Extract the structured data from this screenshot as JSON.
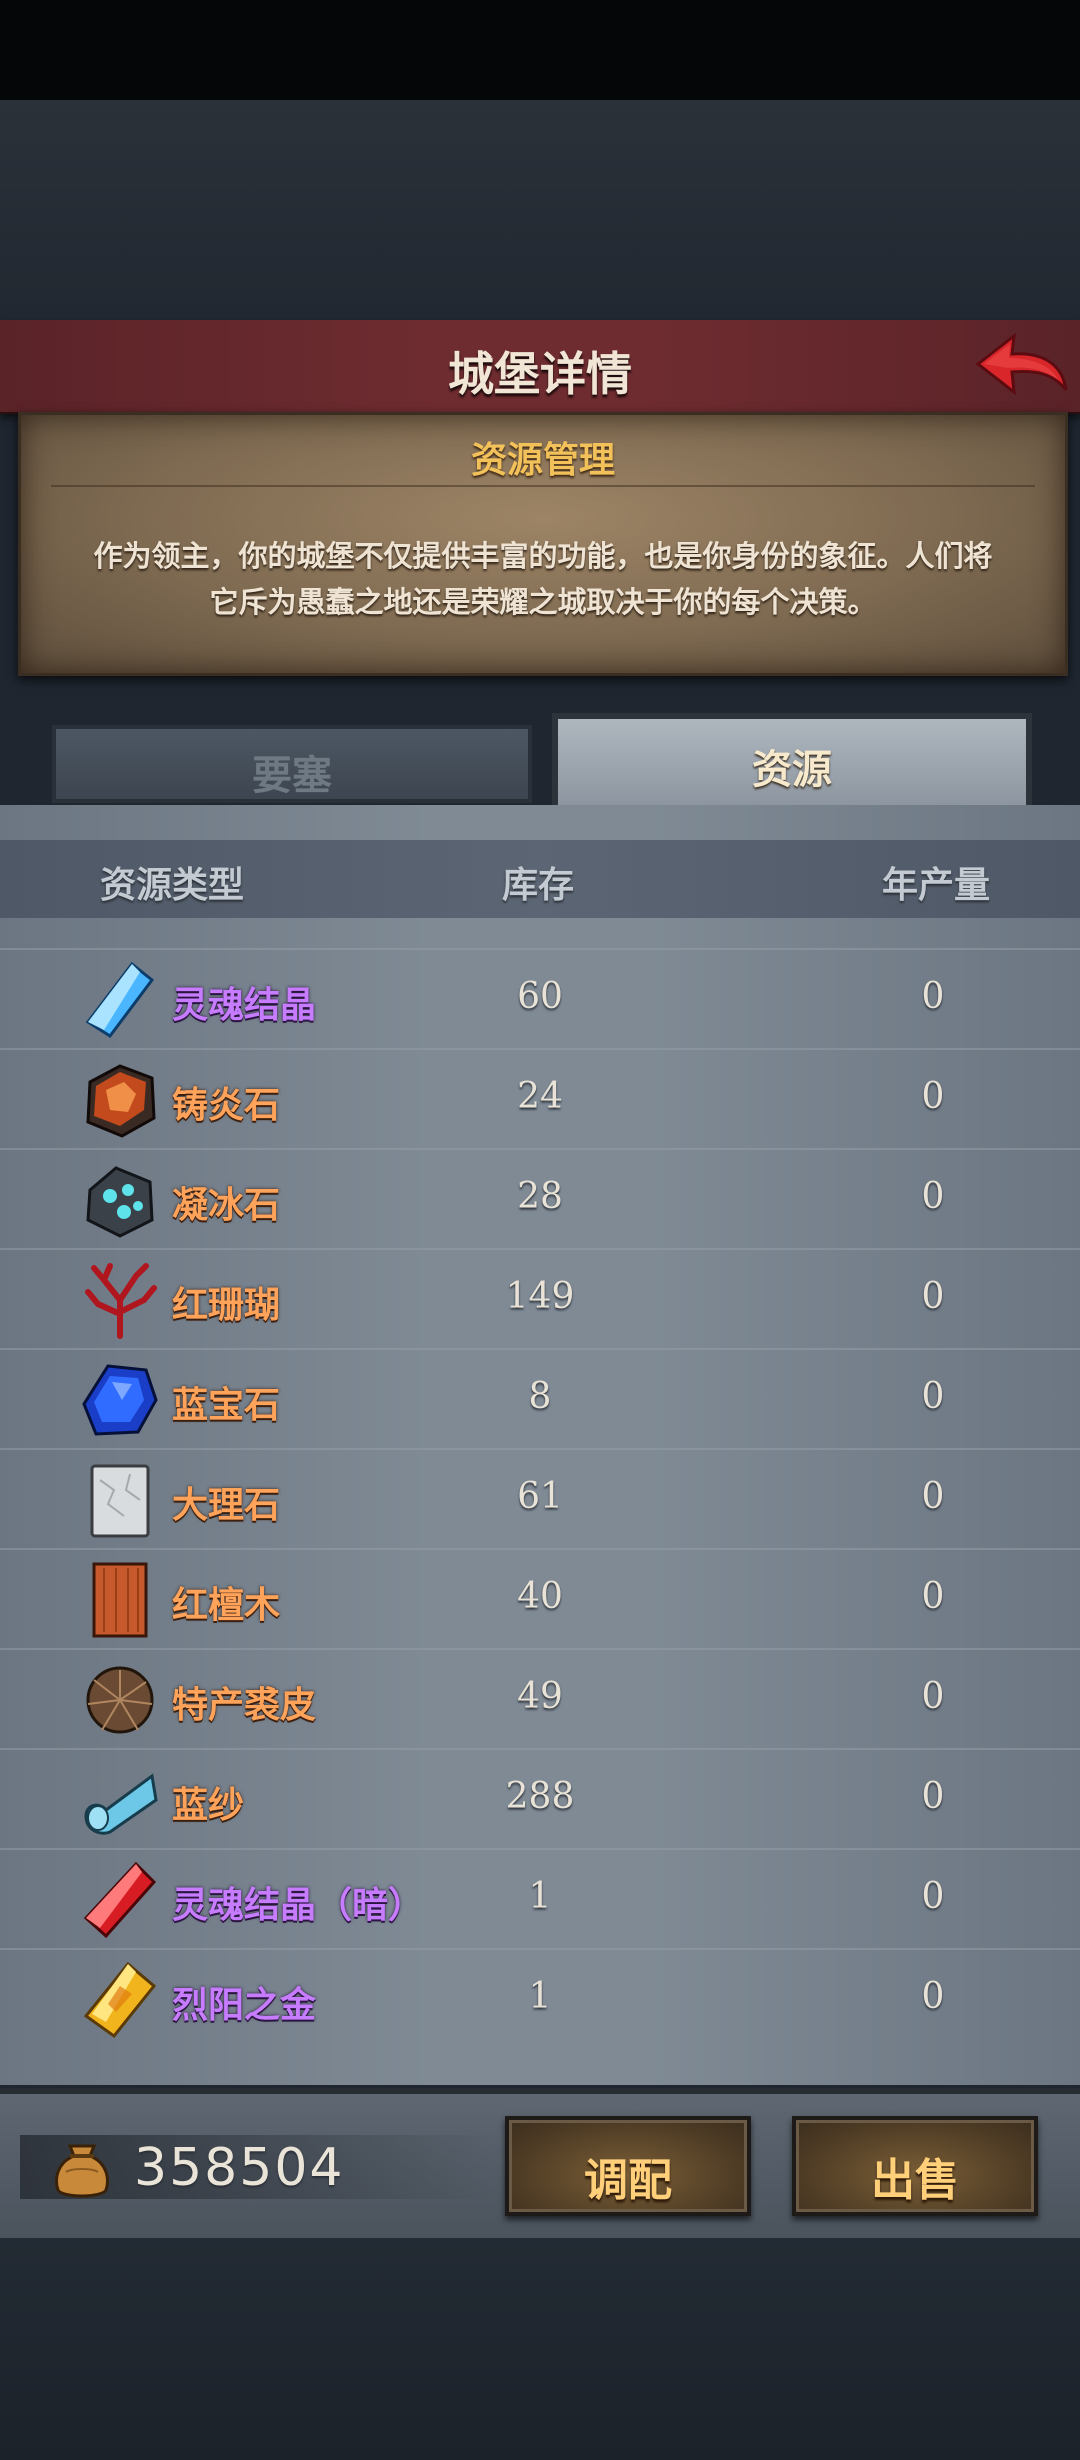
{
  "header": {
    "title": "城堡详情"
  },
  "info_panel": {
    "title": "资源管理",
    "description_line1": "作为领主，你的城堡不仅提供丰富的功能，也是你身份的象征。人们将",
    "description_line2": "它斥为愚蠢之地还是荣耀之城取决于你的每个决策。"
  },
  "tabs": [
    {
      "label": "要塞",
      "active": false
    },
    {
      "label": "资源",
      "active": true
    }
  ],
  "table": {
    "columns": [
      "资源类型",
      "库存",
      "年产量"
    ],
    "rows": [
      {
        "name": "灵魂结晶",
        "stock": "60",
        "yield": "0",
        "icon": "blue-crystal-icon",
        "rarity": "purple"
      },
      {
        "name": "铸炎石",
        "stock": "24",
        "yield": "0",
        "icon": "forge-flame-stone-icon",
        "rarity": "orange"
      },
      {
        "name": "凝冰石",
        "stock": "28",
        "yield": "0",
        "icon": "frost-stone-icon",
        "rarity": "orange"
      },
      {
        "name": "红珊瑚",
        "stock": "149",
        "yield": "0",
        "icon": "red-coral-icon",
        "rarity": "orange"
      },
      {
        "name": "蓝宝石",
        "stock": "8",
        "yield": "0",
        "icon": "sapphire-icon",
        "rarity": "orange"
      },
      {
        "name": "大理石",
        "stock": "61",
        "yield": "0",
        "icon": "marble-icon",
        "rarity": "orange"
      },
      {
        "name": "红檀木",
        "stock": "40",
        "yield": "0",
        "icon": "red-sandalwood-icon",
        "rarity": "orange"
      },
      {
        "name": "特产裘皮",
        "stock": "49",
        "yield": "0",
        "icon": "fur-pelt-icon",
        "rarity": "orange"
      },
      {
        "name": "蓝纱",
        "stock": "288",
        "yield": "0",
        "icon": "blue-silk-icon",
        "rarity": "orange"
      },
      {
        "name": "灵魂结晶（暗）",
        "stock": "1",
        "yield": "0",
        "icon": "red-crystal-icon",
        "rarity": "purple"
      },
      {
        "name": "烈阳之金",
        "stock": "1",
        "yield": "0",
        "icon": "sun-gold-icon",
        "rarity": "purple"
      }
    ]
  },
  "footer": {
    "gold_amount": "358504",
    "allocate_label": "调配",
    "sell_label": "出售"
  },
  "colors": {
    "orange_name": "#ffa35a",
    "purple_name": "#c77cff",
    "title_banner": "#6e2c30"
  }
}
